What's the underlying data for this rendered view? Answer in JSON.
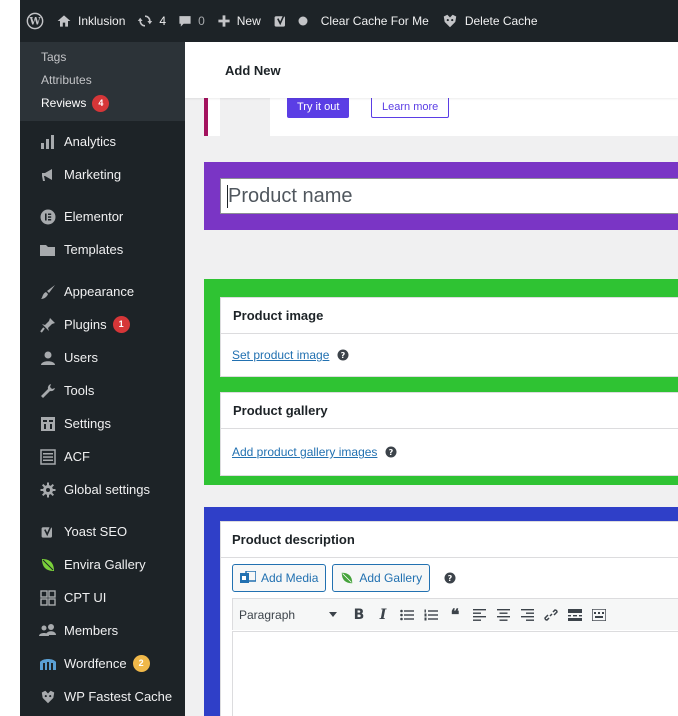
{
  "adminbar": {
    "site_name": "Inklusion",
    "updates_count": "4",
    "comments_count": "0",
    "new_label": "New",
    "clear_cache_label": "Clear Cache For Me",
    "delete_cache_label": "Delete Cache"
  },
  "sidebar": {
    "submenu": [
      {
        "label": "Tags"
      },
      {
        "label": "Attributes"
      },
      {
        "label": "Reviews",
        "badge": "4"
      }
    ],
    "group1": [
      {
        "label": "Analytics",
        "icon": "bar-chart-icon"
      },
      {
        "label": "Marketing",
        "icon": "megaphone-icon"
      }
    ],
    "group2": [
      {
        "label": "Elementor",
        "icon": "elementor-icon"
      },
      {
        "label": "Templates",
        "icon": "folder-icon"
      }
    ],
    "group3": [
      {
        "label": "Appearance",
        "icon": "paintbrush-icon"
      },
      {
        "label": "Plugins",
        "icon": "plugin-icon",
        "badge": "1"
      },
      {
        "label": "Users",
        "icon": "user-icon"
      },
      {
        "label": "Tools",
        "icon": "wrench-icon"
      },
      {
        "label": "Settings",
        "icon": "settings-icon"
      },
      {
        "label": "ACF",
        "icon": "acf-icon"
      },
      {
        "label": "Global settings",
        "icon": "gear-icon"
      }
    ],
    "group4": [
      {
        "label": "Yoast SEO",
        "icon": "yoast-icon"
      },
      {
        "label": "Envira Gallery",
        "icon": "leaf-icon"
      },
      {
        "label": "CPT UI",
        "icon": "grid-icon"
      },
      {
        "label": "Members",
        "icon": "members-icon"
      },
      {
        "label": "Wordfence",
        "icon": "wordfence-icon",
        "badge": "2"
      },
      {
        "label": "WP Fastest Cache",
        "icon": "cheetah-icon"
      }
    ]
  },
  "main": {
    "page_heading": "Add New",
    "notice": {
      "try_label": "Try it out",
      "learn_label": "Learn more"
    },
    "title_placeholder": "Product name",
    "product_image": {
      "heading": "Product image",
      "link": "Set product image"
    },
    "product_gallery": {
      "heading": "Product gallery",
      "link": "Add product gallery images"
    },
    "description": {
      "heading": "Product description",
      "add_media": "Add Media",
      "add_gallery": "Add Gallery",
      "format": "Paragraph"
    }
  },
  "colors": {
    "admin_dark": "#1d2327",
    "submenu": "#2c3338",
    "purple_box": "#7a35c5",
    "green_box": "#2fc333",
    "blue_box": "#2f3fc8",
    "notice_accent": "#a3125e",
    "link": "#2271b1",
    "badge_red": "#d63638",
    "badge_orange": "#f0b849"
  }
}
